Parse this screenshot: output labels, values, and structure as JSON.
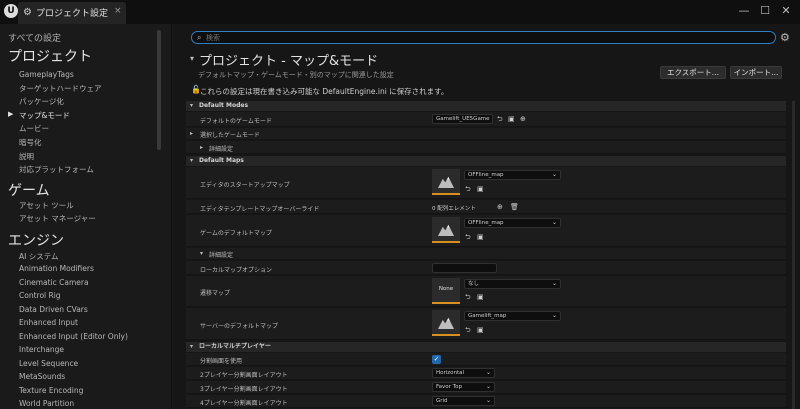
{
  "window": {
    "tab_title": "プロジェクト設定",
    "tab_close": "×",
    "logo": "U",
    "controls": [
      "—",
      "☐",
      "✕"
    ]
  },
  "sidebar": {
    "all_settings": "すべての設定",
    "sections": [
      {
        "title": "プロジェクト",
        "items": [
          "GameplayTags",
          "ターゲットハードウェア",
          "パッケージ化",
          "マップ&モード",
          "ムービー",
          "暗号化",
          "説明",
          "対応プラットフォーム"
        ],
        "selected": 3
      },
      {
        "title": "ゲーム",
        "items": [
          "アセット ツール",
          "アセット マネージャー"
        ]
      },
      {
        "title": "エンジン",
        "items": [
          "AI システム",
          "Animation Modifiers",
          "Cinematic Camera",
          "Control Rig",
          "Data Driven CVars",
          "Enhanced Input",
          "Enhanced Input (Editor Only)",
          "Interchange",
          "Level Sequence",
          "MetaSounds",
          "Texture Encoding",
          "World Partition"
        ]
      }
    ]
  },
  "search": {
    "placeholder": "検索"
  },
  "header": {
    "title": "プロジェクト - マップ&モード",
    "description": "デフォルトマップ・ゲームモード・別のマップに関連した設定",
    "saved_note": "これらの設定は現在書き込み可能な DefaultEngine.ini に保存されます。",
    "export_label": "エクスポート...",
    "import_label": "インポート..."
  },
  "default_modes": {
    "category": "Default Modes",
    "game_mode_label": "デフォルトのゲームモード",
    "game_mode_value": "Gamelift_UE5Game",
    "selected_mode_label": "選択したゲームモード",
    "advanced_label": "詳細設定"
  },
  "default_maps": {
    "category": "Default Maps",
    "editor_startup_label": "エディタのスタートアップマップ",
    "editor_startup_value": "OFFline_map",
    "template_override_label": "エディタテンプレートマップオーバーライド",
    "template_override_value": "0 配列エレメント",
    "game_default_label": "ゲームのデフォルトマップ",
    "game_default_value": "OFFline_map",
    "advanced_label": "詳細設定",
    "local_map_options_label": "ローカルマップオプション",
    "transition_map_label": "遷移マップ",
    "transition_map_thumb": "None",
    "transition_map_value": "なし",
    "server_default_label": "サーバーのデフォルトマップ",
    "server_default_value": "Gamelift_map"
  },
  "local_multiplayer": {
    "category": "ローカルマルチプレイヤー",
    "split_screen_label": "分割画面を使用",
    "two_player_label": "2プレイヤー分割画面レイアウト",
    "two_player_value": "Horizontal",
    "three_player_label": "3プレイヤー分割画面レイアウト",
    "three_player_value": "Favor Top",
    "four_player_label": "4プレイヤー分割画面レイアウト",
    "four_player_value": "Grid"
  },
  "icons": {
    "search": "⌕",
    "gear": "⚙",
    "lock": "🔓",
    "browse": "⮌",
    "folder": "▣",
    "add": "⊕",
    "trash": "🗑",
    "chevron": "⌄",
    "check": "✓",
    "caret_down": "▾",
    "caret_right": "▸"
  },
  "colors": {
    "accent_blue": "#2d7ec5",
    "thumbnail_orange": "#d7901f",
    "checkbox_blue": "#2168ad"
  }
}
